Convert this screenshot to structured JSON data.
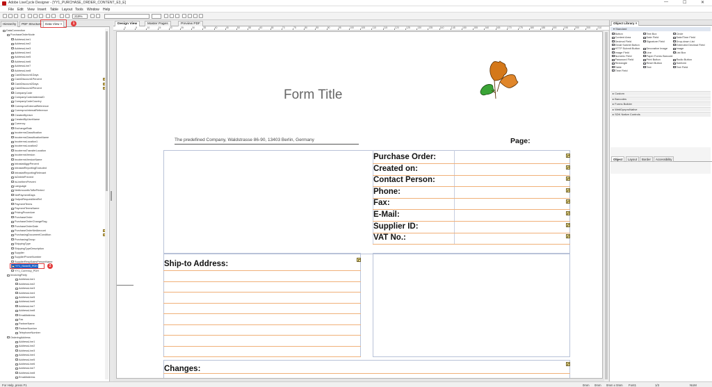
{
  "window": {
    "title": "Adobe LiveCycle Designer - [YY1_PURCHASE_ORDER_CONTENT_E3_E]",
    "minimize": "—",
    "maximize": "☐",
    "close": "✕"
  },
  "menu": [
    "File",
    "Edit",
    "View",
    "Insert",
    "Table",
    "Layout",
    "Tools",
    "Window",
    "Help"
  ],
  "toolbar": {
    "zoom": "219%"
  },
  "left_tabs": {
    "hierarchy": "Hierarchy",
    "pdf_structure": "PDF Structure",
    "data_view": "Data View ×"
  },
  "markers": {
    "one": "1",
    "two": "2"
  },
  "tree": {
    "items": [
      "DataConnection",
      "PurchaseOrderNode",
      "AddressLine1",
      "AddressLine2",
      "AddressLine3",
      "AddressLine4",
      "AddressLine5",
      "AddressLine6",
      "AddressLine7",
      "AddressLine8",
      "CashDiscount1Days",
      "CashDiscount1Percent",
      "CashDiscount2Days",
      "CashDiscount2Percent",
      "CompanyCode",
      "CompanyCodeAddressID",
      "CompanyCodeCountry",
      "CorrespncExternalReference",
      "CorrespncInternalReference",
      "CreatedByUser",
      "CreatedByUserName",
      "Currency",
      "ExchangeRate",
      "IncotermsClassification",
      "IncotermsClassificationName",
      "IncotermsLocation1",
      "IncotermsLocation2",
      "IncotermsTransferLocation",
      "IncotermsVersion",
      "IncotermsVersionName",
      "IntrastatAggrPercent",
      "IntrastatReportingExcluded",
      "IntrastatReportingRelevant",
      "IsDeletePrevent",
      "IsLineItemPrevent",
      "Language",
      "NetAmountIsToBePrinted",
      "NetPaymentDays",
      "OutputRequestItemRef",
      "PaymentTerms",
      "PaymentTermsName",
      "PricingProcedure",
      "PurchaseOrder",
      "PurchaseOrderChangeFlag",
      "PurchaseOrderDate",
      "PurchaseOrderNetAmount",
      "PurchasingDocumentCondition",
      "PurchasingGroup",
      "ShippingType",
      "ShippingTypeDescription",
      "Supplier",
      "SupplierPhoneNumber",
      "SupplierRespSalesPersonName",
      "YY1_Nickel5_PDH",
      "YY1_Currency_PDH",
      "InvoicingParty",
      "AddressLine1",
      "AddressLine2",
      "AddressLine3",
      "AddressLine4",
      "AddressLine5",
      "AddressLine6",
      "AddressLine7",
      "AddressLine8",
      "EmailAddress",
      "Fax",
      "PartnerName",
      "PartnerNumber",
      "TelephoneNumber",
      "OrderingAddress",
      "AddressLine1",
      "AddressLine2",
      "AddressLine3",
      "AddressLine4",
      "AddressLine5",
      "AddressLine6",
      "AddressLine7",
      "AddressLine8",
      "EmailAddress"
    ],
    "selected": "YY1_Nickel5_PDH"
  },
  "center_tabs": {
    "design": "Design View",
    "master": "Master Pages",
    "preview": "Preview PDF"
  },
  "ruler": [
    "0",
    "5",
    "10",
    "15",
    "20",
    "25",
    "30",
    "35",
    "40",
    "45",
    "50",
    "55",
    "60",
    "65",
    "70",
    "75",
    "80",
    "85",
    "90",
    "95",
    "100",
    "105",
    "110",
    "115",
    "120",
    "125",
    "130",
    "135",
    "140",
    "145",
    "150",
    "155",
    "160",
    "165",
    "170",
    "175",
    "180",
    "185",
    "190",
    "195",
    "200",
    "205",
    "210"
  ],
  "form": {
    "title": "Form Title",
    "company": "The predefined Company, Waldstrasse 86-90, 13403 Berlin, Germany",
    "page_label": "Page:",
    "po_fields": [
      "Purchase Order:",
      "Created on:",
      "Contact Person:",
      "Phone:",
      "Fax:",
      "E-Mail:",
      "Supplier ID:",
      "VAT No.:"
    ],
    "ship_to": "Ship-to Address:",
    "changes": "Changes:"
  },
  "right_panel": {
    "tab": "Object Library ×",
    "standard": "▾ Standard",
    "items": [
      [
        "Button",
        "Text Box",
        "Circle"
      ],
      [
        "Content Area",
        "Date Field",
        "Date/Time Field"
      ],
      [
        "Decimal Field",
        "Signature Field",
        "Drop-down List"
      ],
      [
        "Email Submit Button",
        "",
        "Extended Decimal Field"
      ],
      [
        "HTTP Submit Button",
        "Decorative Image",
        "Image"
      ],
      [
        "Image Field",
        "Line",
        "List Box"
      ],
      [
        "Numeric Field",
        "Paper Forms Barcode",
        ""
      ],
      [
        "Password Field",
        "Print Button",
        "Radio Button"
      ],
      [
        "Rectangle",
        "Reset Button",
        "Subform"
      ],
      [
        "Table",
        "Text",
        "Text Field"
      ],
      [
        "Time Field",
        "",
        ""
      ]
    ],
    "categories": [
      "▸ Custom",
      "▸ Barcodes",
      "▸ Forms Builder",
      "▸ WebDynproNative",
      "▸ SDK Native Controls"
    ],
    "bottom_tabs": {
      "object": "Object",
      "layout": "Layout",
      "border": "Border",
      "accessibility": "Accessibility"
    }
  },
  "status": {
    "help": "For Help, press F1",
    "pos1": "0mm",
    "pos2": "0mm",
    "size": "0mm x 0mm",
    "font": "Font1",
    "page": "1/3",
    "num": "NUM"
  }
}
